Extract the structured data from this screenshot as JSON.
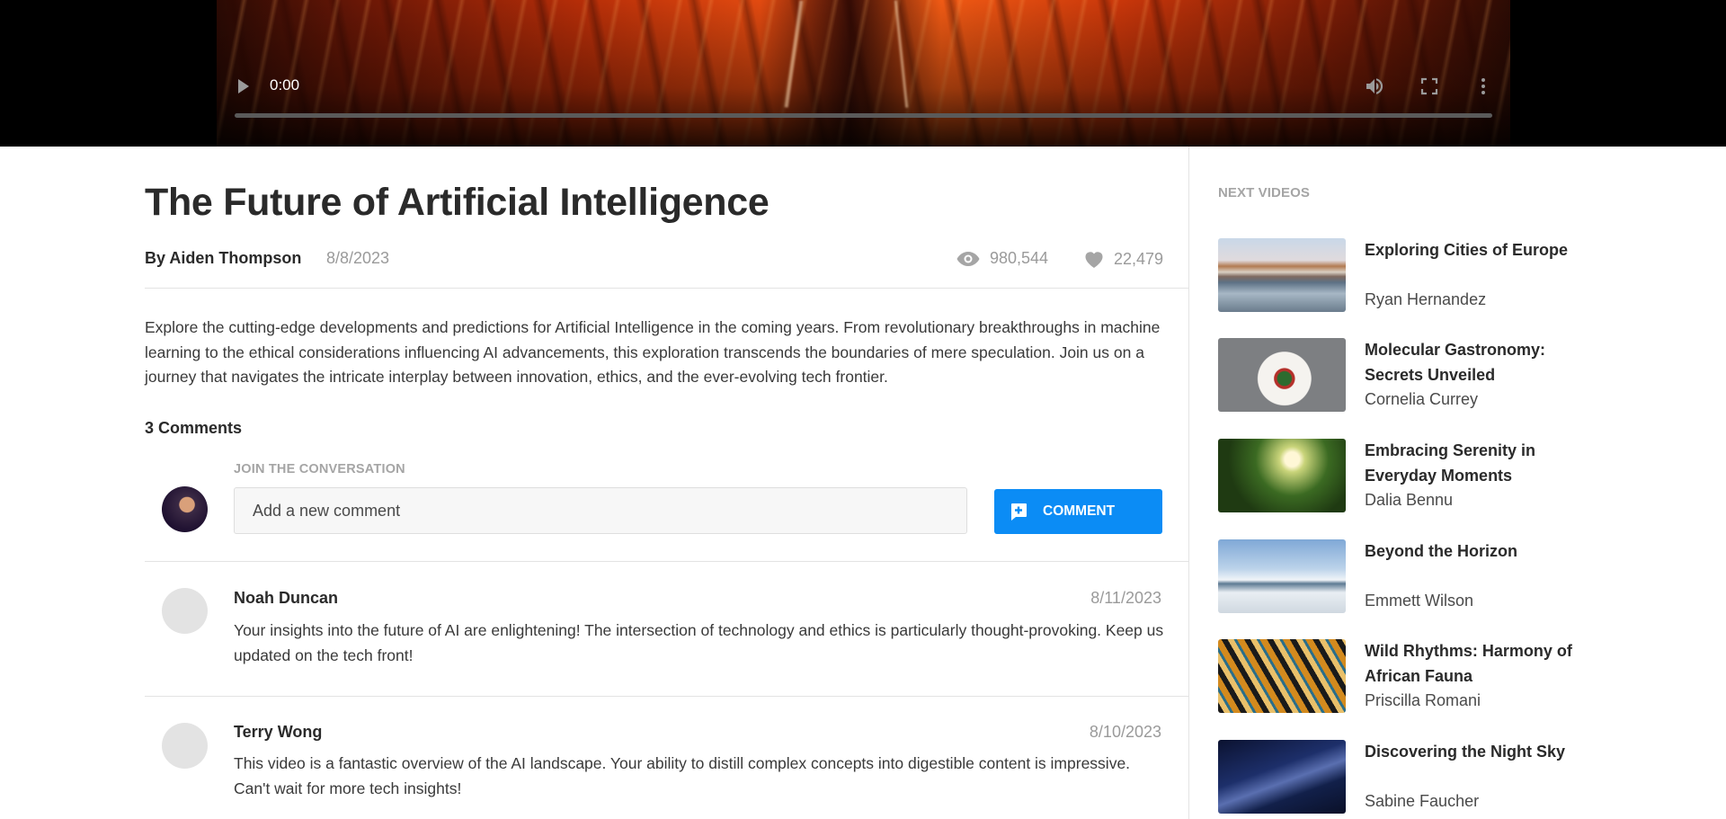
{
  "player": {
    "time": "0:00",
    "progress": 0
  },
  "video": {
    "title": "The Future of Artificial Intelligence",
    "author": "By Aiden Thompson",
    "date": "8/8/2023",
    "views": "980,544",
    "likes": "22,479",
    "description": "Explore the cutting-edge developments and predictions for Artificial Intelligence in the coming years. From revolutionary breakthroughs in machine learning to the ethical considerations influencing AI advancements, this exploration transcends the boundaries of mere speculation. Join us on a journey that navigates the intricate interplay between innovation, ethics, and the ever-evolving tech frontier."
  },
  "comments": {
    "count_label": "3 Comments",
    "join_label": "JOIN THE CONVERSATION",
    "input_placeholder": "Add a new comment",
    "button_label": "COMMENT",
    "items": [
      {
        "name": "Noah Duncan",
        "date": "8/11/2023",
        "text": "Your insights into the future of AI are enlightening! The intersection of technology and ethics is particularly thought-provoking. Keep us updated on the tech front!"
      },
      {
        "name": "Terry Wong",
        "date": "8/10/2023",
        "text": "This video is a fantastic overview of the AI landscape. Your ability to distill complex concepts into digestible content is impressive. Can't wait for more tech insights!"
      }
    ]
  },
  "sidebar": {
    "label": "NEXT VIDEOS",
    "items": [
      {
        "title": "Exploring Cities of Europe",
        "author": "Ryan Hernandez"
      },
      {
        "title": "Molecular Gastronomy: Secrets Unveiled",
        "author": "Cornelia Currey"
      },
      {
        "title": "Embracing Serenity in Everyday Moments",
        "author": "Dalia Bennu"
      },
      {
        "title": "Beyond the Horizon",
        "author": "Emmett Wilson"
      },
      {
        "title": "Wild Rhythms: Harmony of African Fauna",
        "author": "Priscilla Romani"
      },
      {
        "title": "Discovering the Night Sky",
        "author": "Sabine Faucher"
      }
    ]
  },
  "colors": {
    "accent": "#0b8cf5",
    "muted_text": "#9a9a9a",
    "divider": "#e3e3e3"
  }
}
